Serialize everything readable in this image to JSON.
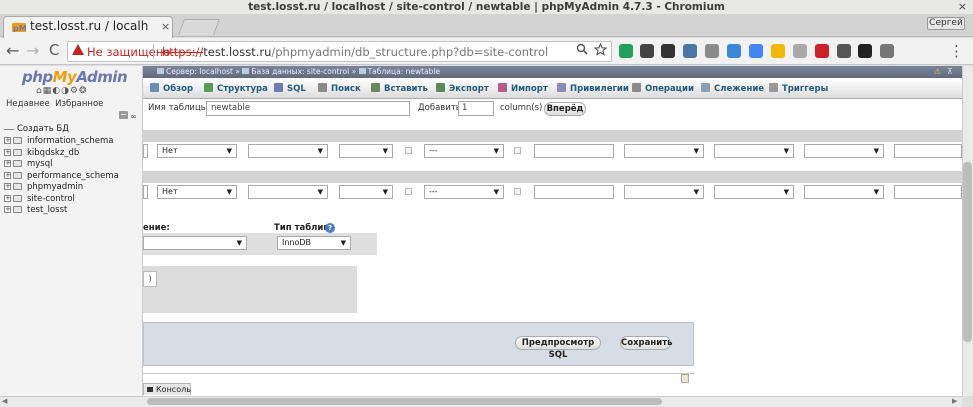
{
  "window": {
    "title": "test.losst.ru / localhost / site-control / newtable | phpMyAdmin 4.7.3 - Chromium",
    "close_glyph": "×"
  },
  "browser": {
    "tab_title": "test.losst.ru / localh",
    "tab_close": "×",
    "user_button": "Сергей",
    "back": "←",
    "forward": "→",
    "reload": "C",
    "security_text": "Не защищено",
    "url_https": "https://",
    "url_host": "test.losst.ru",
    "url_path": "/phpmyadmin/db_structure.php?db=site-control",
    "menu": "⋮",
    "extension_icons": [
      {
        "name": "shield-ext-icon",
        "color": "#22a05a"
      },
      {
        "name": "pocket-ext-icon",
        "color": "#444444"
      },
      {
        "name": "game-ext-icon",
        "color": "#333333"
      },
      {
        "name": "vk-ext-icon",
        "color": "#4a76a8"
      },
      {
        "name": "chrome-ext-icon",
        "color": "#8a8a8a"
      },
      {
        "name": "graph-ext-icon",
        "color": "#3a86d8"
      },
      {
        "name": "translate-ext-icon",
        "color": "#4285f4"
      },
      {
        "name": "bulb-ext-icon",
        "color": "#f2b705"
      },
      {
        "name": "sync-ext-icon",
        "color": "#aaaaaa"
      },
      {
        "name": "pinterest-ext-icon",
        "color": "#cb2027"
      },
      {
        "name": "qr-ext-icon",
        "color": "#555555"
      },
      {
        "name": "mustache-ext-icon",
        "color": "#222222"
      },
      {
        "name": "camera-ext-icon",
        "color": "#777777"
      }
    ]
  },
  "sidebar": {
    "logo_php": "php",
    "logo_my": "My",
    "logo_admin": "Admin",
    "logo_icons": "⌂▦◐◑⚙❂",
    "recent": "Недавнее",
    "favorites": "Избранное",
    "collapse_glyph": "−",
    "link_glyph": "∞",
    "new_db": "Создать БД",
    "databases": [
      "information_schema",
      "kibqdskz_db",
      "mysql",
      "performance_schema",
      "phpmyadmin",
      "site-control",
      "test_losst"
    ]
  },
  "breadcrumb": {
    "server": "Сервер: localhost",
    "database": "База данных: site-control",
    "table": "Таблица: newtable",
    "sep": "»",
    "warn_glyph": "⚠",
    "collapse_glyph": "⊼"
  },
  "topnav": [
    {
      "label": "Обзор",
      "color": "#6a8fb5"
    },
    {
      "label": "Структура",
      "color": "#5a9c5a"
    },
    {
      "label": "SQL",
      "color": "#6a7db5"
    },
    {
      "label": "Поиск",
      "color": "#8a8a8a"
    },
    {
      "label": "Вставить",
      "color": "#6a8a5a"
    },
    {
      "label": "Экспорт",
      "color": "#5a8a5a"
    },
    {
      "label": "Импорт",
      "color": "#b55a8a"
    },
    {
      "label": "Привилегии",
      "color": "#8a8ab5"
    },
    {
      "label": "Операции",
      "color": "#8a8a8a"
    },
    {
      "label": "Слежение",
      "color": "#8aa0b5"
    },
    {
      "label": "Триггеры",
      "color": "#9a9a9a"
    }
  ],
  "form": {
    "table_name_label": "Имя таблицы:",
    "table_name_value": "newtable",
    "add_label": "Добавить",
    "add_value": "1",
    "columns_label": "column(s)",
    "go_button": "Вперёд"
  },
  "column_rows": [
    {
      "default": "Нет",
      "ai_select": "---"
    },
    {
      "default": "Нет",
      "ai_select": "---"
    }
  ],
  "select_arrow": "▼",
  "storage": {
    "collation_label": "ение:",
    "engine_label": "Тип таблиц:",
    "help_glyph": "?",
    "engine_value": "InnoDB"
  },
  "partition": {
    "paren": ")"
  },
  "actions": {
    "preview_sql": "Предпросмотр SQL",
    "save": "Сохранить"
  },
  "console": {
    "label": "Консоль"
  },
  "scroll": {
    "left": "◀",
    "right": "▶"
  }
}
